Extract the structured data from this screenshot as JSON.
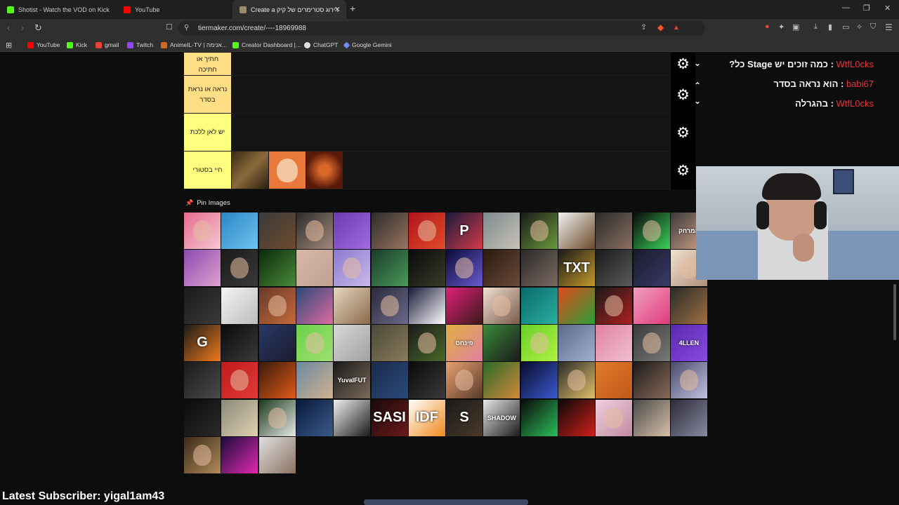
{
  "browser": {
    "tabs": [
      {
        "title": "Shotist - Watch the VOD on Kick",
        "color": "#53fc18",
        "active": false
      },
      {
        "title": "YouTube",
        "color": "#ff0000",
        "active": false
      },
      {
        "title": "Create a דירוג סטרימרים של קיק",
        "color": "#9b8b6b",
        "active": true
      }
    ],
    "url": "tiermaker.com/create/----18969988",
    "bookmarks": [
      {
        "label": "YouTube",
        "color": "#ff0000"
      },
      {
        "label": "Kick",
        "color": "#53fc18"
      },
      {
        "label": "gmail",
        "color": "#ea4335"
      },
      {
        "label": "Twitch",
        "color": "#9146ff"
      },
      {
        "label": "AnimeIL-TV | אנימה...",
        "color": "#d2691e"
      },
      {
        "label": "Creator Dashboard |...",
        "color": "#53fc18"
      },
      {
        "label": "ChatGPT",
        "color": "#e0e0e0"
      },
      {
        "label": "Google Gemini",
        "color": "#6d8cf2"
      }
    ]
  },
  "tiers": [
    {
      "label": "חתיך או חתיכה",
      "style": "orange"
    },
    {
      "label": "נראה או נראת בסדר",
      "style": "orange"
    },
    {
      "label": "יש לאן ללכת",
      "style": "yellow"
    },
    {
      "label": "חיי בסטורי",
      "style": "yellow"
    }
  ],
  "tier_icons": {
    "settings": "⚙"
  },
  "pin_label": "Pin Images",
  "chat": [
    {
      "user": "WtfL0cks",
      "sep": " : ",
      "message": "כמה זוכים יש Stage כל?"
    },
    {
      "user": "babi67",
      "sep": " : ",
      "message": "הוא נראה בסדר"
    },
    {
      "user": "WtfL0cks",
      "sep": " : ",
      "message": "בהגרלה"
    }
  ],
  "grid_labels": {
    "shadow": "SHADOW",
    "allen": "4LLEN",
    "yuvalfut": "YuvalFUT",
    "pinchas": "פינחס",
    "hamarhak": "המרחק",
    "g": "G",
    "s": "S",
    "p": "P",
    "txt": "TXT",
    "sasi": "SASI",
    "idf": "IDF"
  },
  "footer": {
    "latest_subscriber": "Latest Subscriber: yigal1am43"
  },
  "colors": {
    "tier_orange": "#ffde85",
    "tier_yellow": "#ffff7f",
    "chat_user": "#e8333b"
  }
}
